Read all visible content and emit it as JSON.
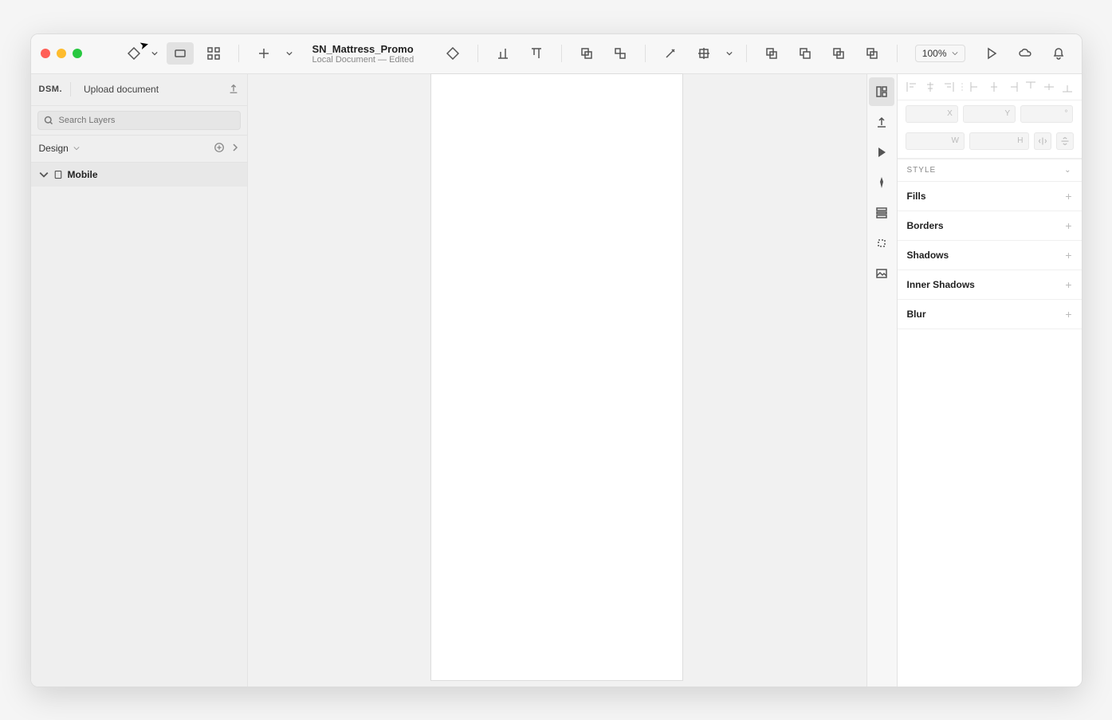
{
  "document": {
    "title": "SN_Mattress_Promo",
    "subtitle": "Local Document — Edited"
  },
  "zoom": {
    "level": "100%"
  },
  "left_panel": {
    "dsm_label": "DSM.",
    "upload_label": "Upload document",
    "search_placeholder": "Search Layers",
    "page_label": "Design",
    "layers": [
      {
        "name": "Mobile"
      }
    ]
  },
  "inspector": {
    "style_header": "STYLE",
    "position": {
      "x_label": "X",
      "y_label": "Y",
      "w_label": "W",
      "h_label": "H",
      "rot_label": "°"
    },
    "sections": [
      {
        "label": "Fills"
      },
      {
        "label": "Borders"
      },
      {
        "label": "Shadows"
      },
      {
        "label": "Inner Shadows"
      },
      {
        "label": "Blur"
      }
    ]
  }
}
